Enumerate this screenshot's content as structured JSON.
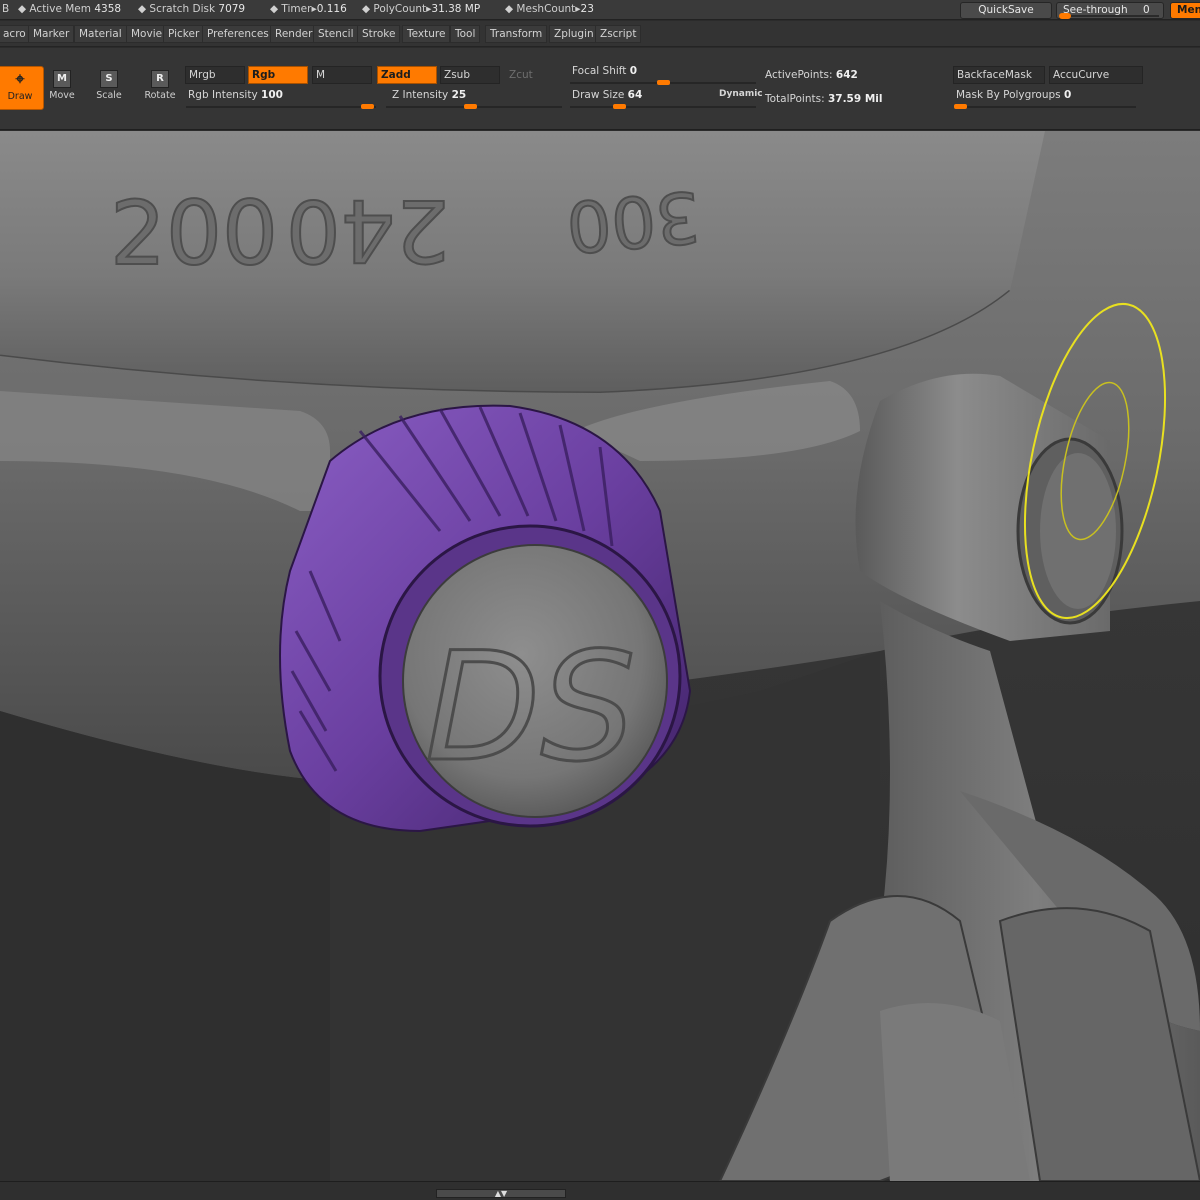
{
  "status": {
    "items": [
      {
        "key": "B",
        "value": ""
      },
      {
        "key": "Active Mem",
        "value": "4358"
      },
      {
        "key": "Scratch Disk",
        "value": "7079"
      },
      {
        "key": "Timer",
        "value": "0.116"
      },
      {
        "key": "PolyCount",
        "value": "31.38 MP"
      },
      {
        "key": "MeshCount",
        "value": "23"
      }
    ],
    "quicksave": "QuickSave",
    "seethrough_label": "See-through",
    "seethrough_value": "0",
    "menus": "Menus"
  },
  "menubar": [
    "acro",
    "Marker",
    "Material",
    "Movie",
    "Picker",
    "Preferences",
    "Render",
    "Stencil",
    "Stroke",
    "Texture",
    "Tool",
    "Transform",
    "Zplugin",
    "Zscript"
  ],
  "tools": {
    "draw": "Draw",
    "move": "Move",
    "move_key": "M",
    "scale": "Scale",
    "scale_key": "S",
    "rotate": "Rotate",
    "rotate_key": "R"
  },
  "shelf": {
    "mrgb": "Mrgb",
    "rgb": "Rgb",
    "m": "M",
    "zadd": "Zadd",
    "zsub": "Zsub",
    "zcut": "Zcut",
    "rgb_intensity_label": "Rgb Intensity",
    "rgb_intensity": "100",
    "z_intensity_label": "Z Intensity",
    "z_intensity": "25",
    "focal_shift_label": "Focal Shift",
    "focal_shift": "0",
    "draw_size_label": "Draw Size",
    "draw_size": "64",
    "dynamic": "Dynamic",
    "active_points_label": "ActivePoints:",
    "active_points": "642",
    "total_points_label": "TotalPoints:",
    "total_points": "37.59 Mil",
    "backface_mask": "BackfaceMask",
    "accucurve": "AccuCurve",
    "mask_polygroups_label": "Mask By Polygroups",
    "mask_polygroups": "0"
  },
  "model": {
    "bezel_numbers": [
      "200",
      "240",
      "300"
    ],
    "crown_logo": "DS",
    "crown_color": "#6a3fa0",
    "accent": "#ff7a00",
    "brush_cursor_color": "#e8e020"
  },
  "bottom": {
    "handle": "▲▼"
  }
}
